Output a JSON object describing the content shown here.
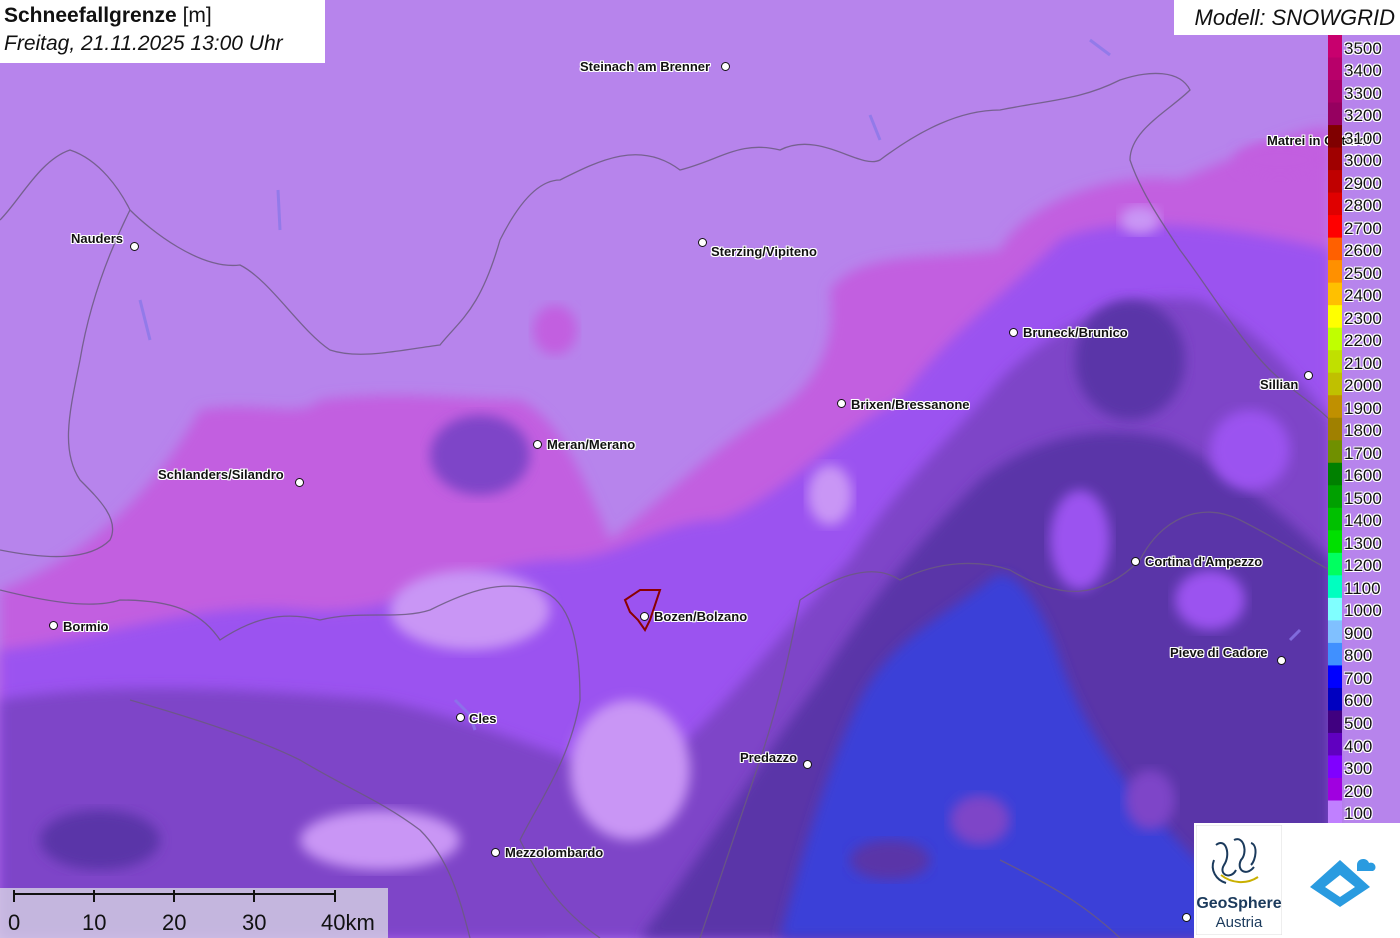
{
  "header": {
    "title_bold": "Schneefallgrenze",
    "title_unit": " [m]",
    "subtitle": "Freitag, 21.11.2025 13:00 Uhr"
  },
  "model_label": "Modell: SNOWGRID",
  "cities": [
    {
      "id": "steinach",
      "name": "Steinach am Brenner"
    },
    {
      "id": "nauders",
      "name": "Nauders"
    },
    {
      "id": "sterzing",
      "name": "Sterzing/Vipiteno"
    },
    {
      "id": "matrei",
      "name": "Matrei in Osttirol"
    },
    {
      "id": "bruneck",
      "name": "Bruneck/Brunico"
    },
    {
      "id": "sillian",
      "name": "Sillian"
    },
    {
      "id": "brixen",
      "name": "Brixen/Bressanone"
    },
    {
      "id": "meran",
      "name": "Meran/Merano"
    },
    {
      "id": "schlanders",
      "name": "Schlanders/Silandro"
    },
    {
      "id": "cortina",
      "name": "Cortina d'Ampezzo"
    },
    {
      "id": "bormio",
      "name": "Bormio"
    },
    {
      "id": "bozen",
      "name": "Bozen/Bolzano"
    },
    {
      "id": "pieve",
      "name": "Pieve di Cadore"
    },
    {
      "id": "cles",
      "name": "Cles"
    },
    {
      "id": "predazzo",
      "name": "Predazzo"
    },
    {
      "id": "mezzolombardo",
      "name": "Mezzolombardo"
    }
  ],
  "legend": {
    "labels": [
      "3500",
      "3400",
      "3300",
      "3200",
      "3100",
      "3000",
      "2900",
      "2800",
      "2700",
      "2600",
      "2500",
      "2400",
      "2300",
      "2200",
      "2100",
      "2000",
      "1900",
      "1800",
      "1700",
      "1600",
      "1500",
      "1400",
      "1300",
      "1200",
      "1100",
      "1000",
      "900",
      "800",
      "700",
      "600",
      "500",
      "400",
      "300",
      "200",
      "100"
    ],
    "colors": [
      "#c8006e",
      "#b8006a",
      "#a80066",
      "#960060",
      "#800000",
      "#a00000",
      "#c00000",
      "#e00000",
      "#ff0000",
      "#ff6000",
      "#ff9000",
      "#ffc000",
      "#ffff00",
      "#c0ff00",
      "#c0e000",
      "#c0c000",
      "#c09000",
      "#a08000",
      "#709000",
      "#008000",
      "#00a000",
      "#00c000",
      "#00e000",
      "#00ff60",
      "#00ffc0",
      "#80ffff",
      "#80c0ff",
      "#4090ff",
      "#0000ff",
      "#0000c0",
      "#400080",
      "#6000c0",
      "#8000ff",
      "#a000e0",
      "#c080ff"
    ]
  },
  "scale": {
    "labels": [
      "0",
      "10",
      "20",
      "30",
      "40km"
    ]
  },
  "logo": {
    "line1": "GeoSphere",
    "line2": "Austria"
  }
}
